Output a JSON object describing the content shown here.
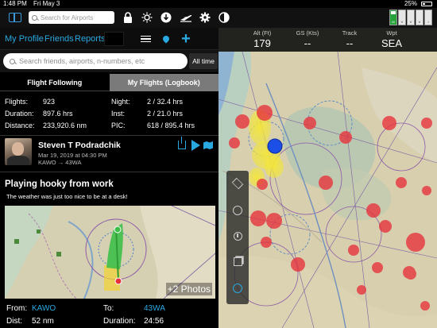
{
  "status_bar": {
    "time": "1:48 PM",
    "date": "Fri May 3",
    "battery": "25%",
    "battery_level": 0.25
  },
  "toolbar": {
    "search_placeholder": "Search for Airports",
    "icons": [
      "sidebar-icon",
      "lock-icon",
      "sun-icon",
      "download-icon",
      "airplane-icon",
      "gear-icon",
      "contrast-icon"
    ],
    "instrument_labels": [
      "M",
      "V",
      "V",
      "V",
      "I"
    ]
  },
  "profile_nav": {
    "my_profile": "My Profile",
    "friends": "Friends",
    "reports": "Reports"
  },
  "friend_search": {
    "placeholder": "Search friends, airports, n-numbers, etc",
    "filter": "All time"
  },
  "tabs": {
    "following": "Flight Following",
    "logbook": "My Flights (Logbook)"
  },
  "stats": {
    "flights_label": "Flights:",
    "flights": "923",
    "duration_label": "Duration:",
    "duration": "897.6 hrs",
    "distance_label": "Distance:",
    "distance": "233,920.6 nm",
    "night_label": "Night:",
    "night": "2 / 32.4 hrs",
    "inst_label": "Inst:",
    "inst": "2 / 21.0 hrs",
    "pic_label": "PIC:",
    "pic": "618 / 895.4 hrs"
  },
  "post": {
    "author": "Steven T Podradchik",
    "date": "Mar 19, 2019 at 04:30 PM",
    "route": "KAWO → 43WA",
    "title": "Playing hooky from work",
    "caption": "The weather was just too nice to be at a desk!",
    "more_photos": "+2 Photos"
  },
  "flight_info": {
    "from_label": "From:",
    "from": "KAWO",
    "to_label": "To:",
    "to": "43WA",
    "dist_label": "Dist:",
    "dist": "52 nm",
    "duration_label": "Duration:",
    "duration": "24:56"
  },
  "map_header": {
    "alt_label": "Alt (Ft)",
    "alt": "179",
    "gs_label": "GS (Kts)",
    "gs": "--",
    "track_label": "Track",
    "track": "--",
    "wpt_label": "Wpt",
    "wpt": "SEA"
  },
  "colors": {
    "accent": "#29a9e0",
    "heat_red": "#e8313a",
    "heat_yellow": "#f3e63a",
    "position_blue": "#1c4fe6"
  }
}
